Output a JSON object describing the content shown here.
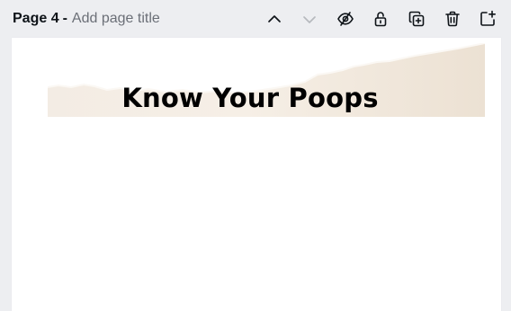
{
  "toolbar": {
    "page_number": "Page 4",
    "separator": "-",
    "title_placeholder": "Add page title",
    "icons": [
      "chevron-up-icon",
      "chevron-down-icon",
      "eye-hide-icon",
      "unlock-icon",
      "duplicate-page-icon",
      "trash-icon",
      "add-page-icon"
    ]
  },
  "canvas": {
    "heading": "Know Your Poops",
    "banner_color": "#efe6dc",
    "heading_color": "#000000"
  }
}
